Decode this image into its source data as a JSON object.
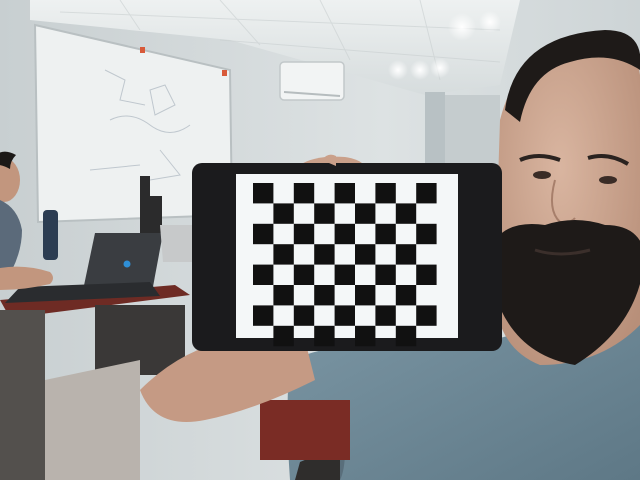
{
  "scene": {
    "kind": "webcam photo",
    "wall_color": "#d9dedf",
    "ceiling_color": "#e6eaea",
    "floor_color": "#b9b3ad",
    "tablet_frame_color": "#1b1b1d",
    "checkerboard": {
      "rows": 7,
      "cols": 10,
      "dark_color": "#111111",
      "light_color": "#f4f7f8"
    },
    "laptop_logo_color": "#2f8fd6",
    "shirt_color": "#6f8a98",
    "skin_color": "#c9a38d",
    "hair_color": "#1e1a18"
  }
}
